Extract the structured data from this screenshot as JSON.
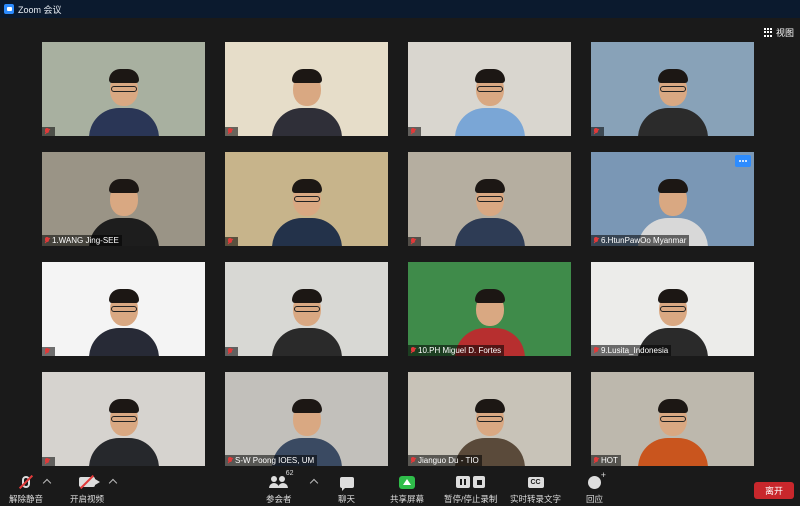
{
  "window": {
    "title": "Zoom 会议",
    "app_icon": "zoom-app-icon"
  },
  "view": {
    "label": "视图",
    "icon": "grid-view-icon"
  },
  "participants": [
    {
      "name": "",
      "bg": "#a8b0a0",
      "shirt": "#2a3656"
    },
    {
      "name": "",
      "bg": "#e6ddc9",
      "shirt": "#2f2f38"
    },
    {
      "name": "",
      "bg": "#d9d6cf",
      "shirt": "#7aa6d6"
    },
    {
      "name": "",
      "bg": "#88a2b8",
      "shirt": "#2b2b2b"
    },
    {
      "name": "1.WANG Jing-SEE",
      "bg": "#9a9486",
      "shirt": "#1d1d1d"
    },
    {
      "name": "",
      "bg": "#c7b48b",
      "shirt": "#23324a"
    },
    {
      "name": "",
      "bg": "#b5aea0",
      "shirt": "#2e3c55"
    },
    {
      "name": "6.HtunPawOo Myanmar",
      "bg": "#7a97b5",
      "shirt": "#d8d8d8"
    },
    {
      "name": "",
      "bg": "#f4f4f4",
      "shirt": "#272a36"
    },
    {
      "name": "",
      "bg": "#d8d8d4",
      "shirt": "#2a2a2a"
    },
    {
      "name": "10.PH Miguel D. Fortes",
      "bg": "#3f8b4a",
      "shirt": "#b72f2f"
    },
    {
      "name": "9.Lusita_Indonesia",
      "bg": "#ececea",
      "shirt": "#2a2a2a"
    },
    {
      "name": "",
      "bg": "#d6d3cf",
      "shirt": "#26282c"
    },
    {
      "name": "S-W Poong IOES, UM",
      "bg": "#c2c0bb",
      "shirt": "#3a4a62"
    },
    {
      "name": "Jianguo Du - TIO",
      "bg": "#c8c3b8",
      "shirt": "#5a4a3a"
    },
    {
      "name": "HOT",
      "bg": "#bdb8ad",
      "shirt": "#c9551e"
    }
  ],
  "toolbar": {
    "unmute": "解除静音",
    "start_video": "开启视频",
    "participants": "参会者",
    "participants_count": "62",
    "chat": "聊天",
    "share_screen": "共享屏幕",
    "record": "暂停/停止录制",
    "live_transcript": "实时转录文字",
    "cc_text": "CC",
    "reactions": "回应",
    "leave": "离开"
  },
  "colors": {
    "titlebar": "#0b1a2e",
    "background": "#1a1a1a",
    "accent": "#2d8cff",
    "share": "#2fbd4a",
    "leave": "#c8272c",
    "muted": "#e03a3a"
  }
}
